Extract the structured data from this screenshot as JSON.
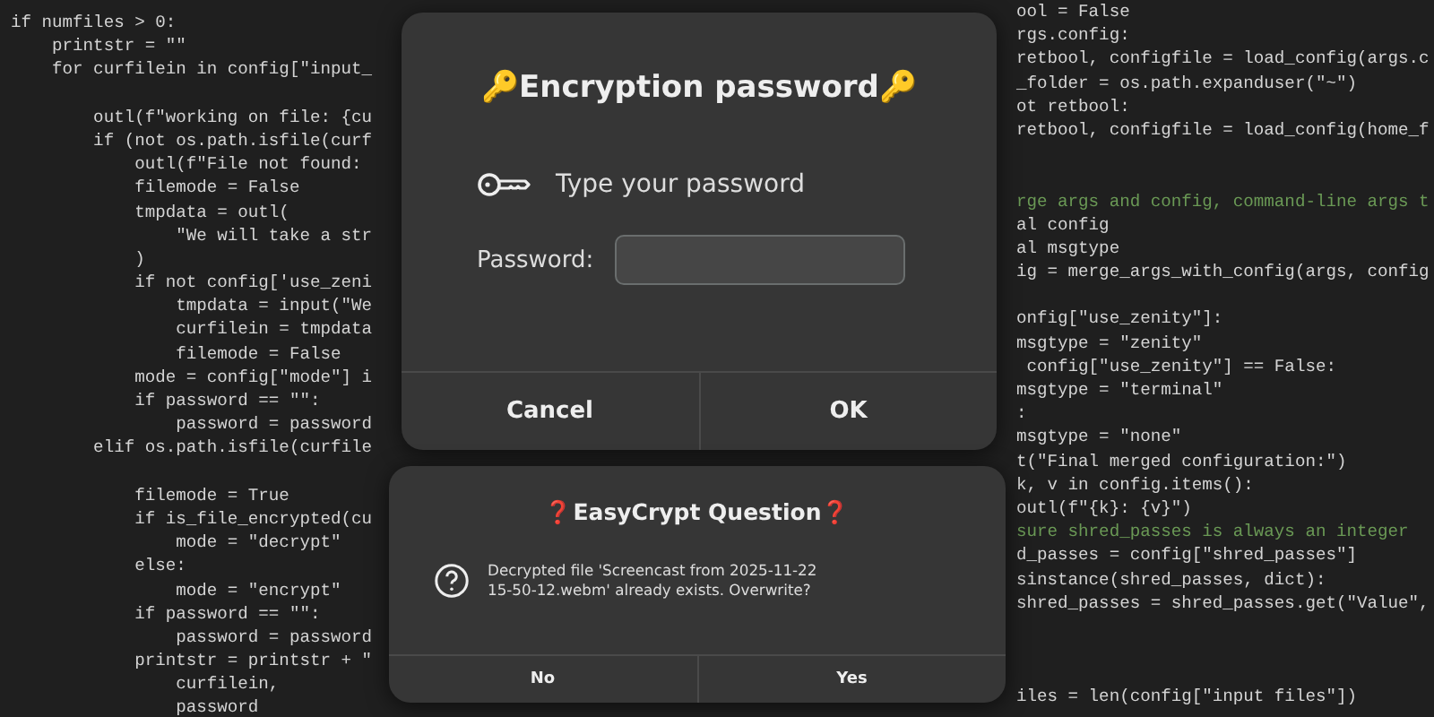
{
  "editor": {
    "left_lines": [
      {
        "kind": "code",
        "text": "if numfiles > 0:"
      },
      {
        "kind": "code",
        "text": "    printstr = \"\""
      },
      {
        "kind": "code",
        "text": "    for curfilein in config[\"input_"
      },
      {
        "kind": "blank"
      },
      {
        "kind": "code",
        "text": "        outl(f\"working on file: {cu"
      },
      {
        "kind": "code",
        "text": "        if (not os.path.isfile(curf"
      },
      {
        "kind": "code",
        "text": "            outl(f\"File not found:"
      },
      {
        "kind": "code",
        "text": "            filemode = False"
      },
      {
        "kind": "code",
        "text": "            tmpdata = outl("
      },
      {
        "kind": "code",
        "text": "                \"We will take a str"
      },
      {
        "kind": "code",
        "text": "            )"
      },
      {
        "kind": "code",
        "text": "            if not config['use_zeni"
      },
      {
        "kind": "code",
        "text": "                tmpdata = input(\"We"
      },
      {
        "kind": "code",
        "text": "                curfilein = tmpdata"
      },
      {
        "kind": "code",
        "text": "                filemode = False"
      },
      {
        "kind": "code",
        "text": "            mode = config[\"mode\"] i"
      },
      {
        "kind": "code",
        "text": "            if password == \"\":"
      },
      {
        "kind": "code",
        "text": "                password = password"
      },
      {
        "kind": "code",
        "text": "        elif os.path.isfile(curfile"
      },
      {
        "kind": "blank"
      },
      {
        "kind": "code",
        "text": "            filemode = True"
      },
      {
        "kind": "code",
        "text": "            if is_file_encrypted(cu"
      },
      {
        "kind": "code",
        "text": "                mode = \"decrypt\""
      },
      {
        "kind": "code",
        "text": "            else:"
      },
      {
        "kind": "code",
        "text": "                mode = \"encrypt\""
      },
      {
        "kind": "code",
        "text": "            if password == \"\":"
      },
      {
        "kind": "code",
        "text": "                password = password"
      },
      {
        "kind": "code",
        "text": "            printstr = printstr + \""
      },
      {
        "kind": "code",
        "text": "                curfilein,"
      },
      {
        "kind": "code",
        "text": "                password"
      }
    ],
    "right_lines": [
      {
        "kind": "code",
        "text": "ool = False"
      },
      {
        "kind": "code",
        "text": "rgs.config:"
      },
      {
        "kind": "code",
        "text": "retbool, configfile = load_config(args.c"
      },
      {
        "kind": "code",
        "text": "_folder = os.path.expanduser(\"~\")"
      },
      {
        "kind": "code",
        "text": "ot retbool:"
      },
      {
        "kind": "code",
        "text": "retbool, configfile = load_config(home_f"
      },
      {
        "kind": "blank"
      },
      {
        "kind": "blank"
      },
      {
        "kind": "comment",
        "text": "rge args and config, command-line args t"
      },
      {
        "kind": "code",
        "text": "al config"
      },
      {
        "kind": "code",
        "text": "al msgtype"
      },
      {
        "kind": "code",
        "text": "ig = merge_args_with_config(args, config"
      },
      {
        "kind": "blank"
      },
      {
        "kind": "code",
        "text": "onfig[\"use_zenity\"]:"
      },
      {
        "kind": "code",
        "text": "msgtype = \"zenity\""
      },
      {
        "kind": "code",
        "text": " config[\"use_zenity\"] == False:"
      },
      {
        "kind": "code",
        "text": "msgtype = \"terminal\""
      },
      {
        "kind": "code",
        "text": ":"
      },
      {
        "kind": "code",
        "text": "msgtype = \"none\""
      },
      {
        "kind": "code",
        "text": "t(\"Final merged configuration:\")"
      },
      {
        "kind": "code",
        "text": "k, v in config.items():"
      },
      {
        "kind": "code",
        "text": "outl(f\"{k}: {v}\")"
      },
      {
        "kind": "comment",
        "text": "sure shred_passes is always an integer"
      },
      {
        "kind": "code",
        "text": "d_passes = config[\"shred_passes\"]"
      },
      {
        "kind": "code",
        "text": "sinstance(shred_passes, dict):"
      },
      {
        "kind": "code",
        "text": "shred_passes = shred_passes.get(\"Value\","
      },
      {
        "kind": "blank"
      },
      {
        "kind": "blank"
      },
      {
        "kind": "blank"
      },
      {
        "kind": "code",
        "text": "iles = len(config[\"input files\"])"
      }
    ]
  },
  "password_dialog": {
    "title": "🔑Encryption password🔑",
    "prompt": "Type your password",
    "field_label": "Password:",
    "buttons": [
      "Cancel",
      "OK"
    ]
  },
  "question_dialog": {
    "title": "❓EasyCrypt Question❓",
    "message": "Decrypted file 'Screencast from 2025-11-22 15-50-12.webm' already exists. Overwrite?",
    "buttons": [
      "No",
      "Yes"
    ]
  }
}
